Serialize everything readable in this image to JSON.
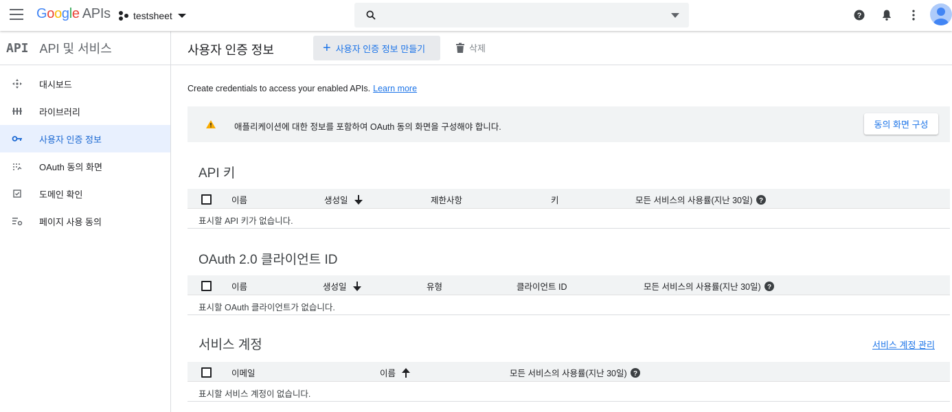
{
  "topbar": {
    "logo_letters": [
      "G",
      "o",
      "o",
      "g",
      "l",
      "e"
    ],
    "logo_apis": "APIs",
    "project_name": "testsheet",
    "search_placeholder": "",
    "icons": [
      "menu-icon",
      "search-icon",
      "help-icon",
      "notifications-icon",
      "more-vert-icon",
      "account-avatar"
    ]
  },
  "sidebar": {
    "mark": "API",
    "title": "API 및 서비스",
    "items": [
      {
        "label": "대시보드",
        "icon": "dashboard-icon",
        "active": false
      },
      {
        "label": "라이브러리",
        "icon": "library-icon",
        "active": false
      },
      {
        "label": "사용자 인증 정보",
        "icon": "key-icon",
        "active": true
      },
      {
        "label": "OAuth 동의 화면",
        "icon": "oauth-consent-icon",
        "active": false
      },
      {
        "label": "도메인 확인",
        "icon": "domain-verify-icon",
        "active": false
      },
      {
        "label": "페이지 사용 동의",
        "icon": "page-usage-icon",
        "active": false
      }
    ]
  },
  "main": {
    "page_title": "사용자 인증 정보",
    "create_button": "사용자 인증 정보 만들기",
    "delete_button": "삭제",
    "intro_text": "Create credentials to access your enabled APIs.",
    "intro_link": "Learn more",
    "banner": {
      "text": "애플리케이션에 대한 정보를 포함하여 OAuth 동의 화면을 구성해야 합니다.",
      "button": "동의 화면 구성"
    },
    "api_keys": {
      "title": "API 키",
      "columns": [
        "이름",
        "생성일",
        "제한사항",
        "키",
        "모든 서비스의 사용률(지난 30일)"
      ],
      "empty": "표시할 API 키가 없습니다."
    },
    "oauth": {
      "title": "OAuth 2.0 클라이언트 ID",
      "columns": [
        "이름",
        "생성일",
        "유형",
        "클라이언트 ID",
        "모든 서비스의 사용률(지난 30일)"
      ],
      "empty": "표시할 OAuth 클라이언트가 없습니다."
    },
    "service_accounts": {
      "title": "서비스 계정",
      "manage_link": "서비스 계정 관리",
      "columns": [
        "이메일",
        "이름",
        "모든 서비스의 사용률(지난 30일)"
      ],
      "empty": "표시할 서비스 계정이 없습니다."
    }
  },
  "colors": {
    "accent": "#1a73e8",
    "active_bg": "#e8f0fe",
    "warning": "#f9ab00",
    "surface": "#f1f3f4"
  }
}
